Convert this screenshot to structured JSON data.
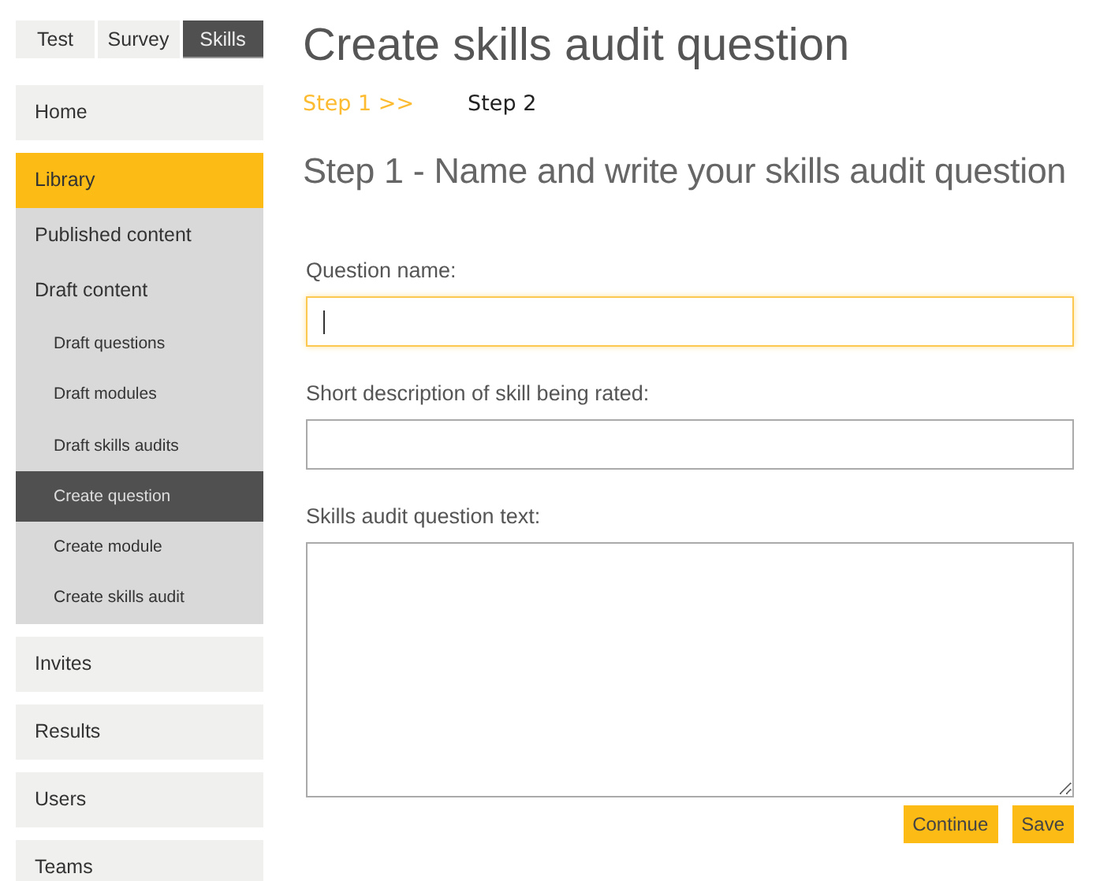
{
  "top_tabs": [
    {
      "label": "Test",
      "selected": false
    },
    {
      "label": "Survey",
      "selected": false
    },
    {
      "label": "Skills",
      "selected": true
    }
  ],
  "menu": [
    {
      "label": "Home",
      "selected": false
    },
    {
      "label": "Library",
      "selected": true,
      "children": [
        {
          "label": "Published content",
          "selected": false
        },
        {
          "label": "Draft content",
          "selected": false,
          "children": [
            {
              "label": "Draft questions",
              "selected": false
            },
            {
              "label": "Draft modules",
              "selected": false
            },
            {
              "label": "Draft skills audits",
              "selected": false
            },
            {
              "label": "Create question",
              "selected": true
            },
            {
              "label": "Create module",
              "selected": false
            },
            {
              "label": "Create skills audit",
              "selected": false
            }
          ]
        }
      ]
    },
    {
      "label": "Invites",
      "selected": false
    },
    {
      "label": "Results",
      "selected": false
    },
    {
      "label": "Users",
      "selected": false
    },
    {
      "label": "Teams",
      "selected": false
    }
  ],
  "page_title": "Create skills audit question",
  "steps": [
    {
      "label": "Step 1 >>",
      "selected": true
    },
    {
      "label": "Step 2",
      "selected": false
    }
  ],
  "section_title": "Step 1 - Name and write your skills audit question",
  "fields": [
    {
      "label": "Question name:",
      "kind": "input",
      "focused": true
    },
    {
      "label": "Short description of skill being rated:",
      "kind": "input",
      "focused": false
    },
    {
      "label": "Skills audit question text:",
      "kind": "textarea",
      "focused": false
    }
  ],
  "buttons": [
    "Continue",
    "Save"
  ]
}
